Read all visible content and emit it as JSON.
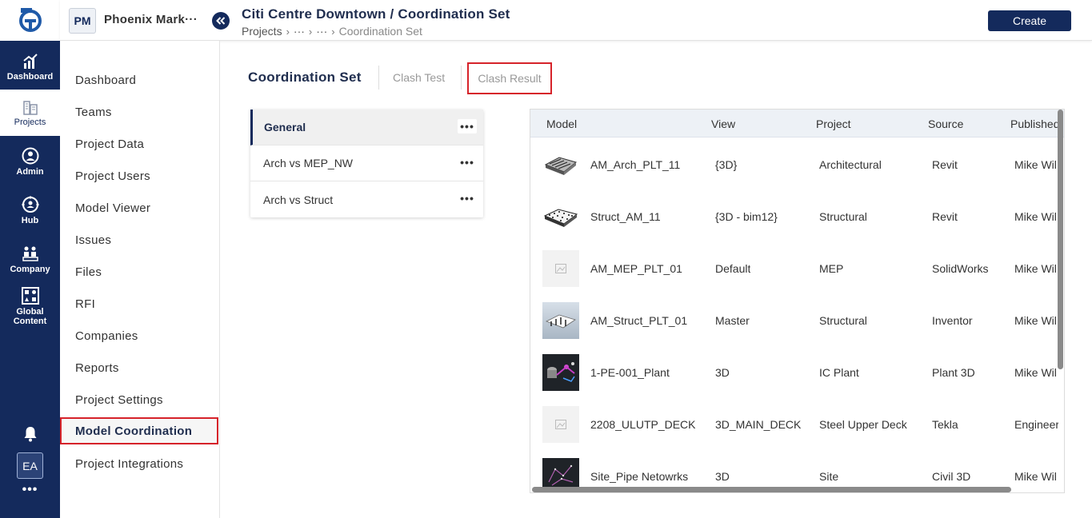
{
  "rail": {
    "items": [
      {
        "label": "Dashboard",
        "icon": "chart-icon"
      },
      {
        "label": "Projects",
        "icon": "building-icon"
      },
      {
        "label": "Admin",
        "icon": "user-icon"
      },
      {
        "label": "Hub",
        "icon": "hub-icon"
      },
      {
        "label": "Company",
        "icon": "company-icon"
      },
      {
        "label": "Global Content",
        "icon": "grid-icon"
      }
    ],
    "avatar": "EA",
    "more": "•••"
  },
  "header": {
    "project_badge": "PM",
    "project_name": "Phoenix Mark···",
    "title": "Citi Centre Downtown / Coordination Set",
    "breadcrumb": [
      "Projects",
      "···",
      "···",
      "Coordination Set"
    ],
    "create_label": "Create"
  },
  "sidebar": {
    "items": [
      "Dashboard",
      "Teams",
      "Project Data",
      "Project Users",
      "Model Viewer",
      "Issues",
      "Files",
      "RFI",
      "Companies",
      "Reports",
      "Project Settings",
      "Model Coordination",
      "Project Integrations"
    ],
    "active": "Model Coordination"
  },
  "tabs": [
    "Coordination Set",
    "Clash Test",
    "Clash Result"
  ],
  "sets": [
    {
      "name": "General",
      "more": "•••"
    },
    {
      "name": "Arch vs MEP_NW",
      "more": "•••"
    },
    {
      "name": "Arch vs Struct",
      "more": "•••"
    }
  ],
  "table": {
    "columns": [
      "Model",
      "View",
      "Project",
      "Source",
      "Published"
    ],
    "rows": [
      {
        "model": "AM_Arch_PLT_11",
        "view": "{3D}",
        "project": "Architectural",
        "source": "Revit",
        "published": "Mike Wil"
      },
      {
        "model": "Struct_AM_11",
        "view": "{3D - bim12}",
        "project": "Structural",
        "source": "Revit",
        "published": "Mike Wil"
      },
      {
        "model": "AM_MEP_PLT_01",
        "view": "Default",
        "project": "MEP",
        "source": "SolidWorks",
        "published": "Mike Wil"
      },
      {
        "model": "AM_Struct_PLT_01",
        "view": "Master",
        "project": "Structural",
        "source": "Inventor",
        "published": "Mike Wil"
      },
      {
        "model": "1-PE-001_Plant",
        "view": "3D",
        "project": "IC Plant",
        "source": "Plant 3D",
        "published": "Mike Wil"
      },
      {
        "model": "2208_ULUTP_DECK",
        "view": "3D_MAIN_DECK",
        "project": "Steel Upper Deck",
        "source": "Tekla",
        "published": "Engineerc"
      },
      {
        "model": "Site_Pipe Netowrks",
        "view": "3D",
        "project": "Site",
        "source": "Civil 3D",
        "published": "Mike Wil"
      }
    ]
  },
  "colors": {
    "navy": "#142a5c",
    "highlight": "#d6232a"
  }
}
